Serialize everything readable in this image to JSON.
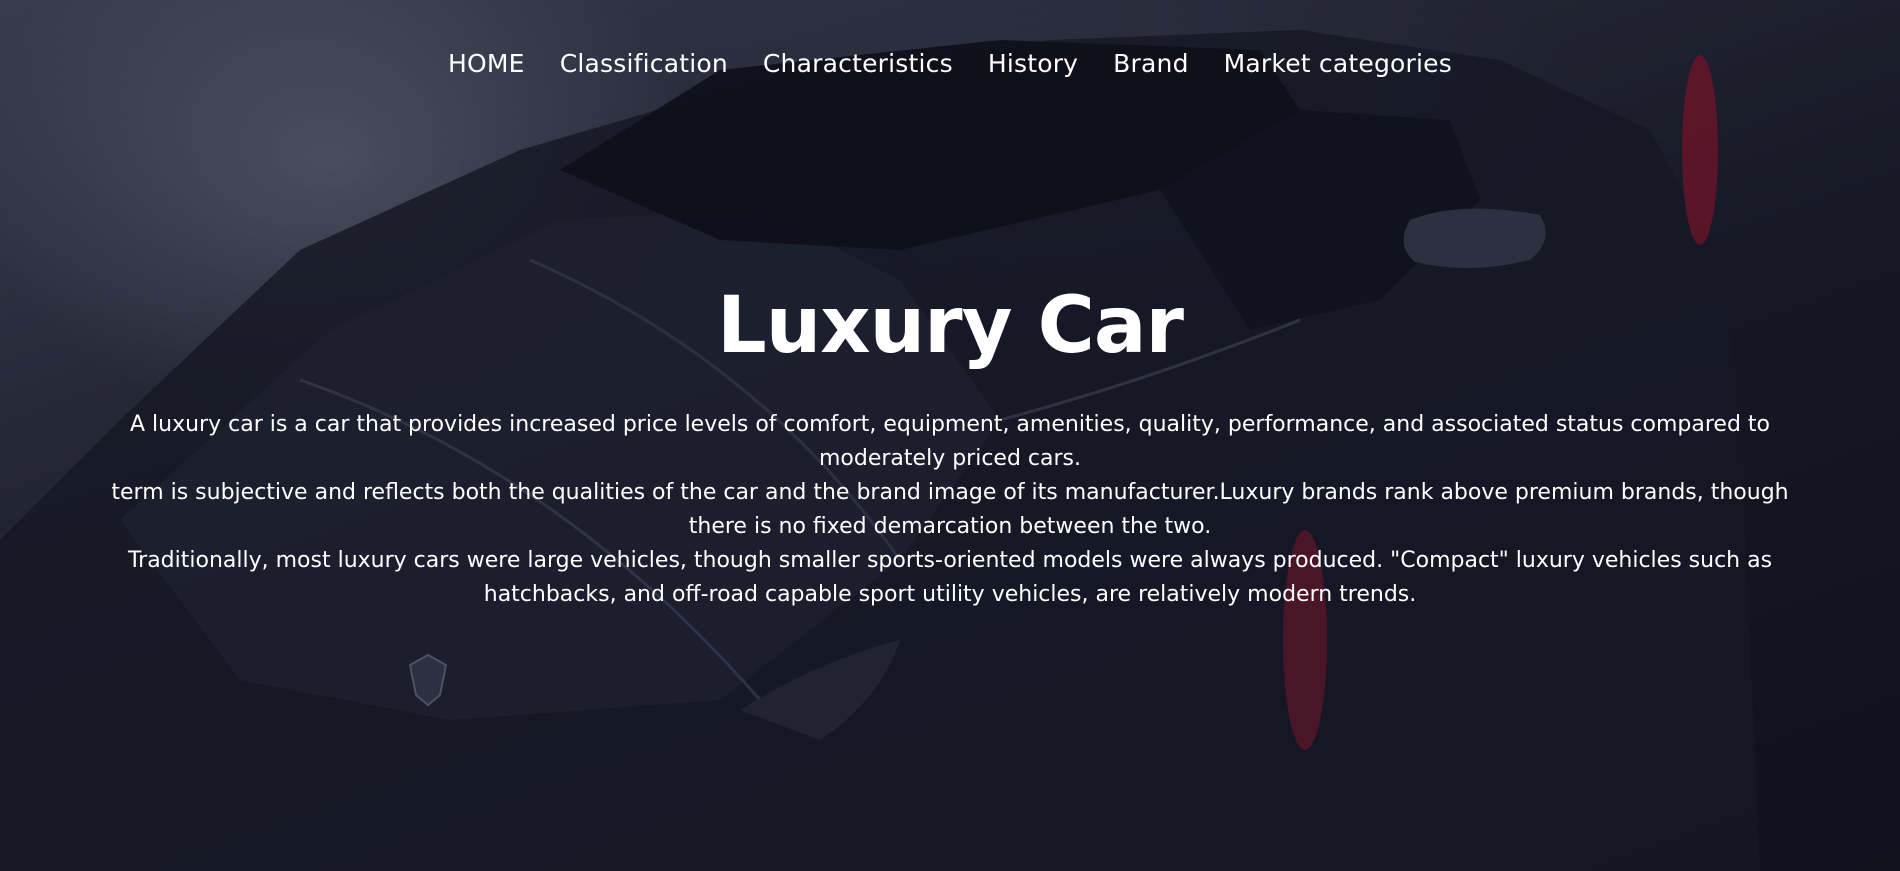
{
  "nav": {
    "items": [
      {
        "label": "HOME"
      },
      {
        "label": "Classification"
      },
      {
        "label": "Characteristics"
      },
      {
        "label": "History"
      },
      {
        "label": "Brand"
      },
      {
        "label": "Market categories"
      }
    ]
  },
  "hero": {
    "title": "Luxury Car",
    "paragraphs": [
      "A luxury car is a car that provides increased price levels of comfort, equipment, amenities, quality, performance, and associated status compared to moderately priced cars.",
      "term is subjective and reflects both the qualities of the car and the brand image of its manufacturer.Luxury brands rank above premium brands, though there is no fixed demarcation between the two.",
      "Traditionally, most luxury cars were large vehicles, though smaller sports-oriented models were always produced. \"Compact\" luxury vehicles such as hatchbacks, and off-road capable sport utility vehicles, are relatively modern trends."
    ]
  },
  "colors": {
    "background": "#12131f",
    "text": "#ffffff",
    "tail_light": "#a0162e"
  },
  "icons": {
    "background_image": "sports-car-photo",
    "emblem": "bull-emblem-icon"
  }
}
